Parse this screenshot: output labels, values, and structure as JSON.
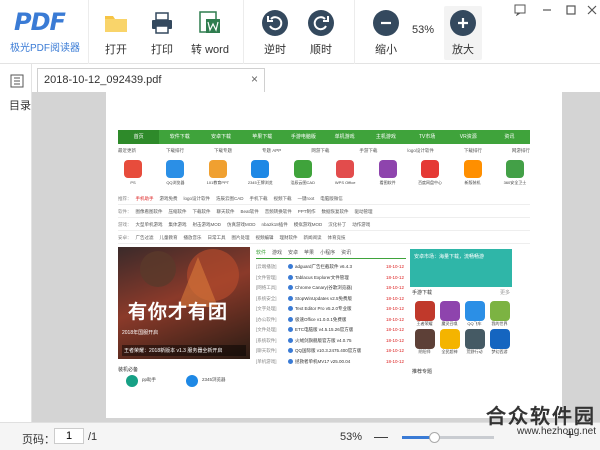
{
  "app": {
    "logo_mark": "PDF",
    "logo_subtitle": "极光PDF阅读器",
    "accent": "#3a7bd5"
  },
  "toolbar": {
    "open_label": "打开",
    "print_label": "打印",
    "to_word_label": "转 word",
    "rotate_ccw_label": "逆时",
    "rotate_cw_label": "顺时",
    "zoom_out_label": "缩小",
    "zoom_pct": "53%",
    "zoom_in_label": "放大"
  },
  "sidebar": {
    "toc_label": "目录"
  },
  "tab": {
    "title": "2018-10-12_092439.pdf",
    "close": "×"
  },
  "status": {
    "page_label": "页码：",
    "page_value": "1",
    "page_total": "/1",
    "zoom": "53%",
    "zoom_level": 0.35
  },
  "watermark": {
    "name": "合众软件园",
    "url": "www.hezhong.net"
  },
  "webpage": {
    "nav": [
      "首页",
      "软件下载",
      "安卓下载",
      "苹果下载",
      "手游电脑版",
      "单机游戏",
      "主机游戏",
      "TV市场",
      "VR资源",
      "资讯"
    ],
    "sub": [
      "最近更新",
      "下载排行",
      "下载专题",
      "专题 APP",
      "网游下载",
      "手游下载",
      "logo设计软件",
      "下载排行",
      "网游排行"
    ],
    "apps": [
      {
        "name": "PS",
        "color": "#e74c3c"
      },
      {
        "name": "QQ浏览器",
        "color": "#2b8fe6"
      },
      {
        "name": "101教育PPT",
        "color": "#f0a030"
      },
      {
        "name": "2345王牌浏览",
        "color": "#1e88e5"
      },
      {
        "name": "浩辰云图CAD",
        "color": "#3fa33b"
      },
      {
        "name": "WPS Office",
        "color": "#e24c4c"
      },
      {
        "name": "看图软件",
        "color": "#8e44ad"
      },
      {
        "name": "百度网盘中心",
        "color": "#e53935"
      },
      {
        "name": "新版装机",
        "color": "#ff8f00"
      },
      {
        "name": "360安全卫士",
        "color": "#43a047"
      }
    ],
    "rows": [
      {
        "label": "推荐：",
        "items": [
          "手机助手",
          "游戏免费",
          "logo设计软件",
          "浩辰云图CAD",
          "手机下载",
          "视频下载",
          "一键root",
          "电脑版微信"
        ],
        "red_index": 0
      },
      {
        "label": "软件：",
        "items": [
          "图像看图软件",
          "压缩软件",
          "下载软件",
          "聊天软件",
          "Beat软件",
          "音频转换软件",
          "PPT制作",
          "数据恢复软件",
          "驱动管理"
        ],
        "red_index": -1
      },
      {
        "label": "游戏：",
        "items": [
          "大型单机游戏",
          "集体游戏",
          "射击游戏MOD",
          "仿真游戏MOD",
          "nba2k18插件",
          "模拟游戏MOD",
          "汉化补丁",
          "动作游戏"
        ],
        "red_index": -1
      },
      {
        "label": "安卓：",
        "items": [
          "广告过滤",
          "儿童教育",
          "播放音乐",
          "日常工具",
          "图片处理",
          "视频编辑",
          "理财软件",
          "新闻阅读",
          "体育竞技"
        ],
        "red_index": -1
      }
    ],
    "banner_title": "有你才有团",
    "banner_sub": "2018年国服开启",
    "banner_caption": "王者荣耀：2018新版本 v1.3 服务器全新开启",
    "tabs": [
      "软件",
      "游戏",
      "安卓",
      "苹果",
      "小程序",
      "资讯"
    ],
    "list": [
      {
        "cat": "[云端播放]",
        "name": "adguard广告拦截软件 v6.4.3",
        "date": "18-10-12"
      },
      {
        "cat": "[文件管理]",
        "name": "Tablacus Explorer文件管理",
        "date": "18-10-12"
      },
      {
        "cat": "[网络工具]",
        "name": "Chrome Canary(谷歌浏览器)",
        "date": "18-10-12"
      },
      {
        "cat": "[系统安全]",
        "name": "StopWinUpdates v2.5免费版",
        "date": "18-10-12"
      },
      {
        "cat": "[文字处理]",
        "name": "Text Editor Pro v5.2.0专业版",
        "date": "18-10-12"
      },
      {
        "cat": "[办公软件]",
        "name": "极速Office v1.0.0.1免费版",
        "date": "18-10-12"
      },
      {
        "cat": "[文件处理]",
        "name": "ETC电脑版 v4.5.15.26官方版",
        "date": "18-10-12"
      },
      {
        "cat": "[系统软件]",
        "name": "火绒剑旗舰版官方版 v4.0.75",
        "date": "18-10-12"
      },
      {
        "cat": "[聊天软件]",
        "name": "QQ国际版 v10.3.2475.400官方版",
        "date": "18-10-12"
      },
      {
        "cat": "[单机游戏]",
        "name": "拯救者单机MV17 v25.00.04",
        "date": "18-10-12"
      }
    ],
    "promo": "安卓市场：海量下载，流畅畅游",
    "download_head": "手游下载",
    "more": "更多",
    "downloads": [
      {
        "name": "王者荣耀",
        "color": "#c0392b"
      },
      {
        "name": "魔灵召唤",
        "color": "#8e44ad"
      },
      {
        "name": "QQ飞车",
        "color": "#2b8fe6"
      },
      {
        "name": "我的世界",
        "color": "#7cb342"
      },
      {
        "name": "阴阳师",
        "color": "#5d4037"
      },
      {
        "name": "全民超神",
        "color": "#f4b400"
      },
      {
        "name": "荒野行动",
        "color": "#455a64"
      },
      {
        "name": "梦幻西游",
        "color": "#1565c0"
      }
    ],
    "nec_head": "装机必备",
    "rec_head": "推荐专题",
    "nec_items": [
      {
        "name": "pp助手",
        "color": "#16a085"
      },
      {
        "name": "2345浏览器",
        "color": "#1e88e5"
      }
    ]
  }
}
